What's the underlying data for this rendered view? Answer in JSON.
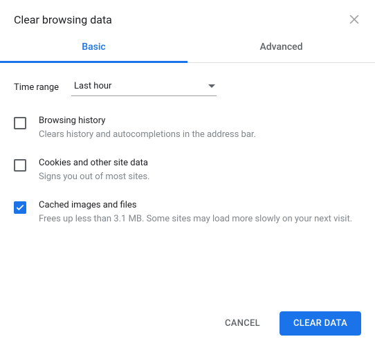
{
  "dialog": {
    "title": "Clear browsing data",
    "tabs": {
      "basic": "Basic",
      "advanced": "Advanced"
    },
    "timeRange": {
      "label": "Time range",
      "value": "Last hour"
    },
    "options": [
      {
        "title": "Browsing history",
        "desc": "Clears history and autocompletions in the address bar.",
        "checked": false
      },
      {
        "title": "Cookies and other site data",
        "desc": "Signs you out of most sites.",
        "checked": false
      },
      {
        "title": "Cached images and files",
        "desc": "Frees up less than 3.1 MB. Some sites may load more slowly on your next visit.",
        "checked": true
      }
    ],
    "buttons": {
      "cancel": "CANCEL",
      "clear": "CLEAR DATA"
    }
  }
}
